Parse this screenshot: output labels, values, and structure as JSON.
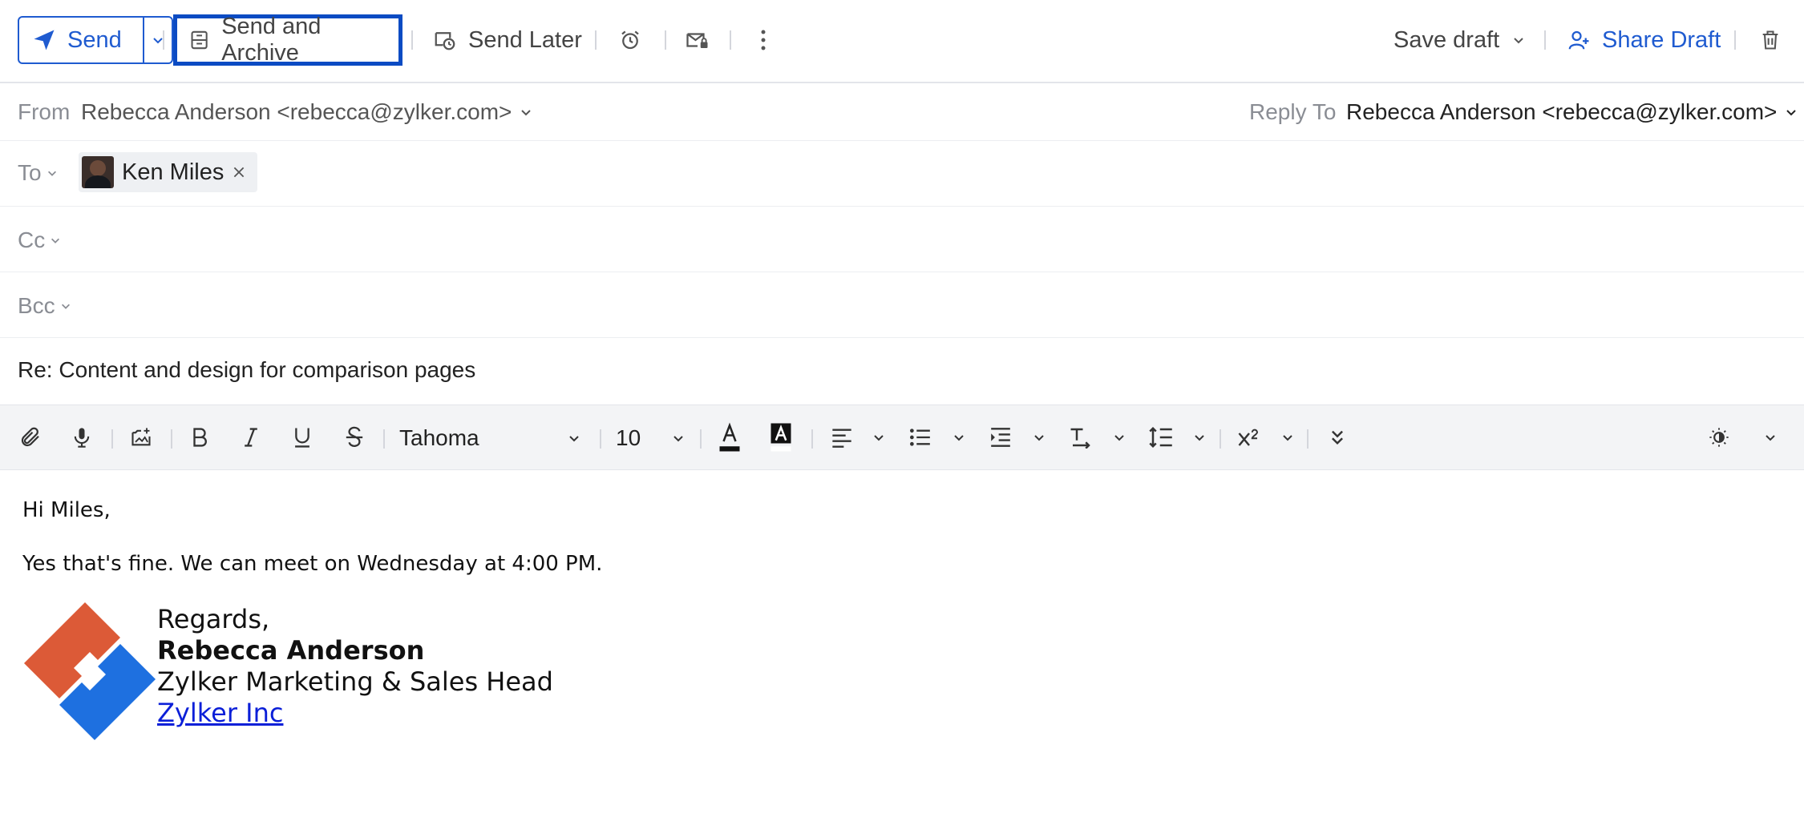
{
  "toolbar": {
    "send_label": "Send",
    "send_archive_label": "Send and Archive",
    "send_later_label": "Send Later",
    "save_draft_label": "Save draft",
    "share_draft_label": "Share Draft"
  },
  "header": {
    "from_label": "From",
    "from_value": "Rebecca Anderson <rebecca@zylker.com>",
    "reply_to_label": "Reply To",
    "reply_to_value": "Rebecca Anderson <rebecca@zylker.com>",
    "to_label": "To",
    "to_recipient": "Ken Miles",
    "cc_label": "Cc",
    "bcc_label": "Bcc",
    "subject": "Re: Content and design for comparison pages"
  },
  "format": {
    "font_family": "Tahoma",
    "font_size": "10"
  },
  "body": {
    "greeting": "Hi Miles,",
    "message": "Yes that's fine. We can meet on Wednesday at 4:00 PM.",
    "signature": {
      "regards": "Regards,",
      "name": "Rebecca Anderson",
      "title": "Zylker Marketing & Sales Head",
      "company": "Zylker Inc"
    }
  },
  "colors": {
    "accent": "#1f5bd0",
    "highlight_border": "#0b4bc3",
    "logo_orange": "#dc5a37",
    "logo_blue": "#1e70e0"
  }
}
